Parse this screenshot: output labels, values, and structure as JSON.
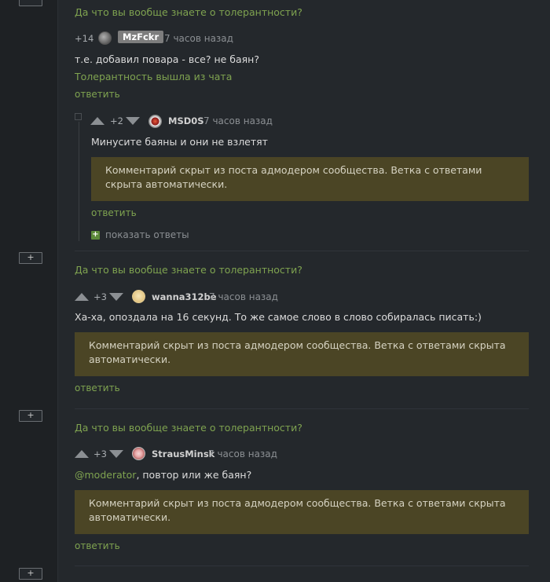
{
  "thread": {
    "top_collapse_label": "−",
    "collapse_label": "+",
    "post_link_1": "Да что вы вообще знаете о толерантности?",
    "comment_1": {
      "rating": "+14",
      "author": "MzFckr",
      "time": "7 часов назад",
      "text": "т.е. добавил повара - все? не баян?",
      "signature": "Толерантность вышла из чата",
      "reply": "ответить"
    },
    "comment_1_reply": {
      "rating": "+2",
      "author": "MSD0S",
      "time": "7 часов назад",
      "text": "Минусите баяны и они не взлетят",
      "hidden_notice": "Комментарий скрыт из поста адмодером сообщества. Ветка с ответами скрыта автоматически.",
      "reply": "ответить",
      "show_replies": "показать ответы"
    },
    "post_link_2": "Да что вы вообще знаете о толерантности?",
    "comment_2": {
      "rating": "+3",
      "author": "wanna312be",
      "time": "7 часов назад",
      "text": "Ха-ха, опоздала на 16 секунд. То же самое слово в слово собиралась писать:)",
      "hidden_notice": "Комментарий скрыт из поста адмодером сообщества. Ветка с ответами скрыта автоматически.",
      "reply": "ответить"
    },
    "post_link_3": "Да что вы вообще знаете о толерантности?",
    "comment_3": {
      "rating": "+3",
      "author": "StrausMinsk",
      "time": "7 часов назад",
      "mention": "@moderator",
      "text_rest": ", повтор или же баян?",
      "hidden_notice": "Комментарий скрыт из поста адмодером сообщества. Ветка с ответами скрыта автоматически.",
      "reply": "ответить"
    }
  },
  "colors": {
    "background": "#24282c",
    "accent_green": "#7fa350",
    "hidden_box": "#4b4525"
  }
}
